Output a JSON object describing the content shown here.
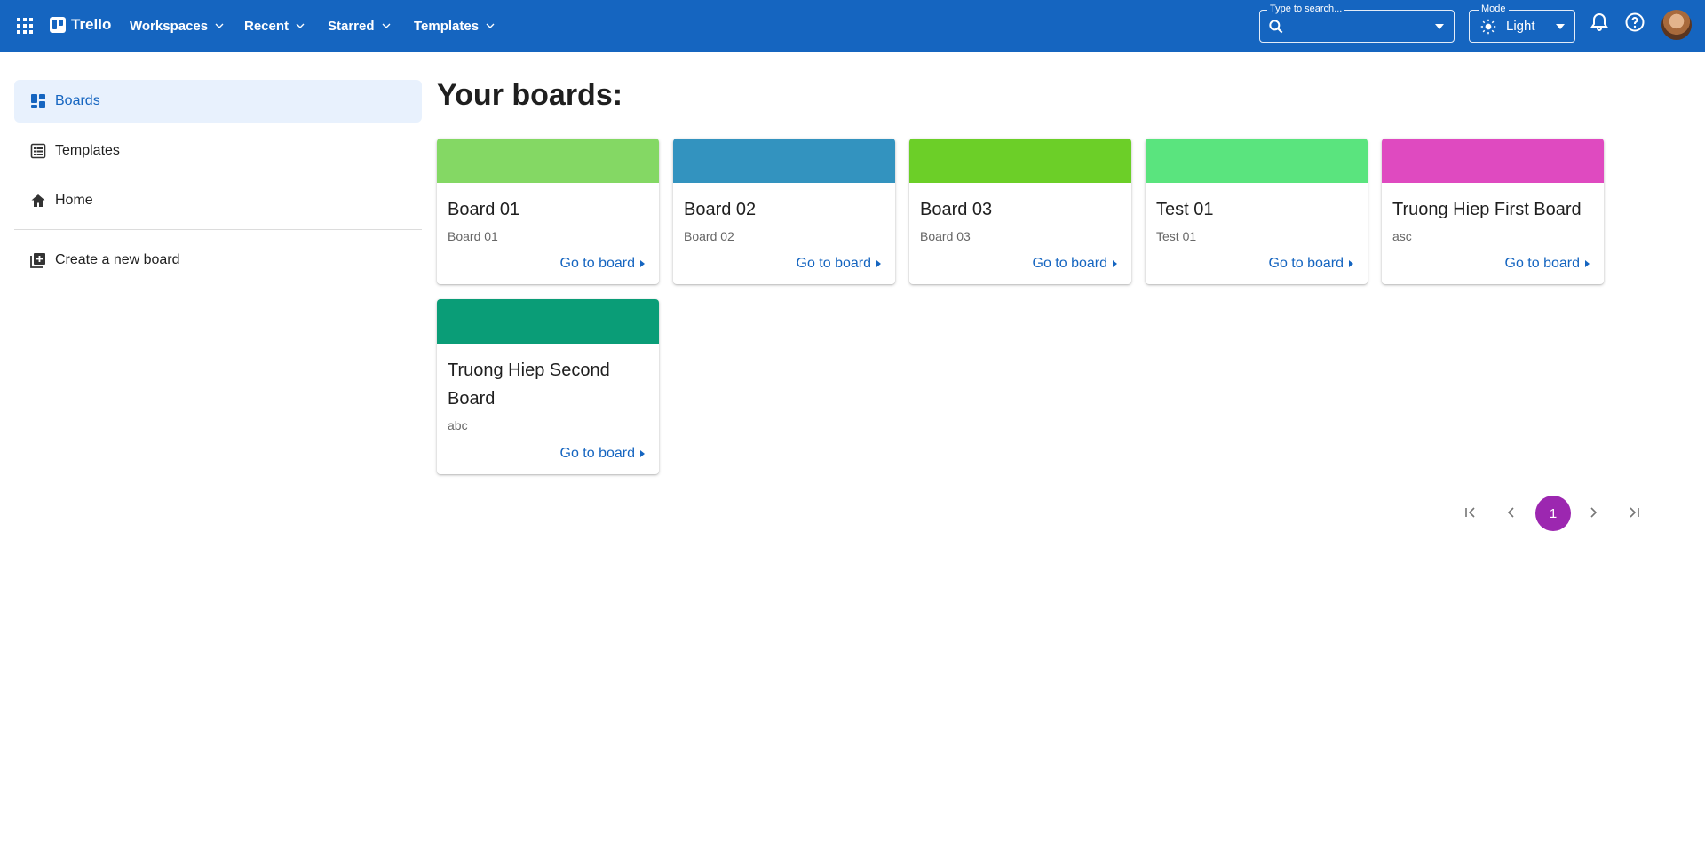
{
  "header": {
    "app_name": "Trello",
    "nav": [
      {
        "label": "Workspaces"
      },
      {
        "label": "Recent"
      },
      {
        "label": "Starred"
      },
      {
        "label": "Templates"
      }
    ],
    "search": {
      "label": "Type to search...",
      "value": ""
    },
    "mode": {
      "label": "Mode",
      "value": "Light"
    },
    "colors": {
      "bar": "#1565c0"
    }
  },
  "sidebar": {
    "items": [
      {
        "label": "Boards",
        "icon": "dashboard-icon",
        "active": true
      },
      {
        "label": "Templates",
        "icon": "list-alt-icon",
        "active": false
      },
      {
        "label": "Home",
        "icon": "home-icon",
        "active": false
      }
    ],
    "create": {
      "label": "Create a new board",
      "icon": "library-add-icon"
    }
  },
  "main": {
    "title": "Your boards:",
    "boards": [
      {
        "title": "Board 01",
        "description": "Board 01",
        "cover": "#84d864",
        "link": "Go to board"
      },
      {
        "title": "Board 02",
        "description": "Board 02",
        "cover": "#3393bf",
        "link": "Go to board"
      },
      {
        "title": "Board 03",
        "description": "Board 03",
        "cover": "#6ccf28",
        "link": "Go to board"
      },
      {
        "title": "Test 01",
        "description": "Test 01",
        "cover": "#5ae47e",
        "link": "Go to board"
      },
      {
        "title": "Truong Hiep First Board",
        "description": "asc",
        "cover": "#df4ac0",
        "link": "Go to board"
      },
      {
        "title": "Truong Hiep Second Board",
        "description": "abc",
        "cover": "#0a9d77",
        "link": "Go to board"
      }
    ],
    "pagination": {
      "current_page": "1"
    }
  }
}
